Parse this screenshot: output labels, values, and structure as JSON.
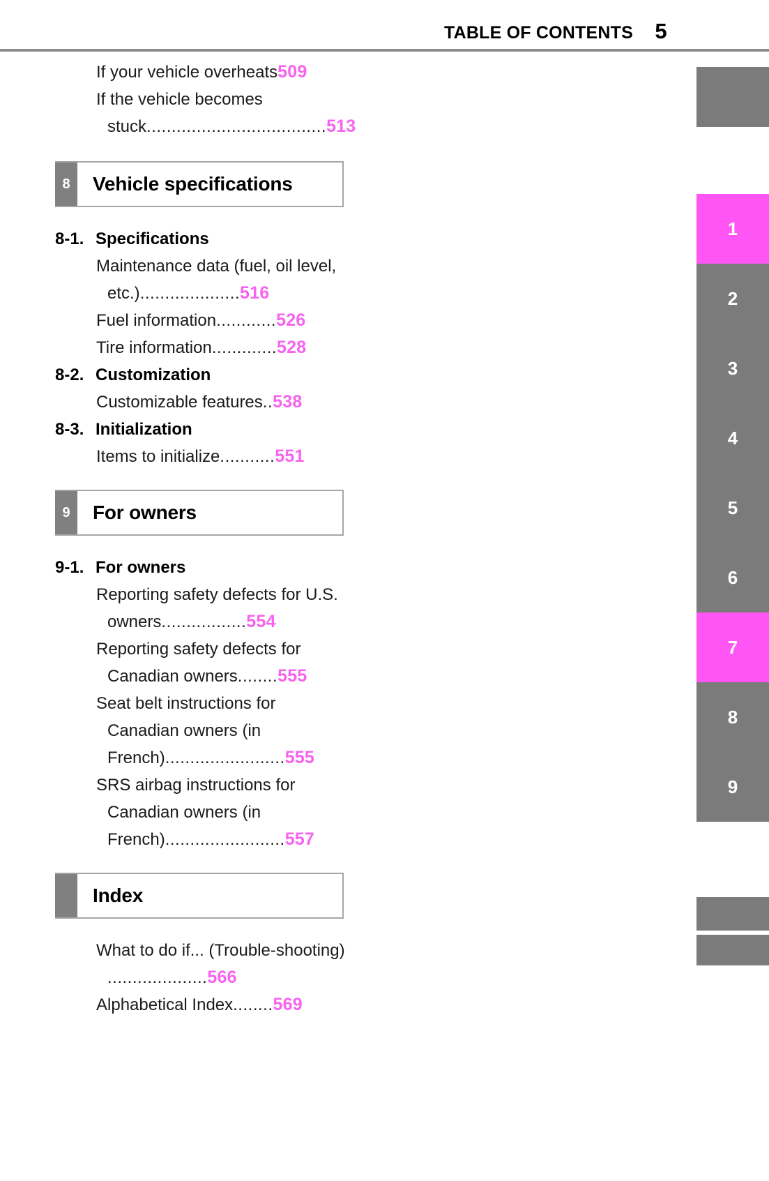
{
  "header": {
    "title": "TABLE OF CONTENTS",
    "page_number": "5"
  },
  "colors": {
    "page_number_accent": "#F763F0",
    "tab_gray": "#7b7b7b",
    "tab_active": "#FF55F4",
    "rule_gray": "#8c8c8c"
  },
  "toc": {
    "leading_entries": [
      {
        "title": "If your vehicle overheats",
        "leader": "",
        "page": "509"
      },
      {
        "title": "If the vehicle becomes stuck",
        "leader": "....................................",
        "page": "513"
      }
    ],
    "chapters": [
      {
        "number": "8",
        "title": "Vehicle specifications",
        "sections": [
          {
            "number": "8-1.",
            "title": "Specifications",
            "entries": [
              {
                "title": "Maintenance data (fuel, oil level, etc.)",
                "leader": "....................",
                "page": "516"
              },
              {
                "title": "Fuel information",
                "leader": "............",
                "page": "526"
              },
              {
                "title": "Tire information",
                "leader": ".............",
                "page": "528"
              }
            ]
          },
          {
            "number": "8-2.",
            "title": "Customization",
            "entries": [
              {
                "title": "Customizable features",
                "leader": "..",
                "page": "538"
              }
            ]
          },
          {
            "number": "8-3.",
            "title": "Initialization",
            "entries": [
              {
                "title": "Items to initialize",
                "leader": "...........",
                "page": "551"
              }
            ]
          }
        ]
      },
      {
        "number": "9",
        "title": "For owners",
        "sections": [
          {
            "number": "9-1.",
            "title": "For owners",
            "entries": [
              {
                "title": "Reporting safety defects for U.S. owners",
                "leader": ".................",
                "page": "554"
              },
              {
                "title": "Reporting safety defects for Canadian owners",
                "leader": "........",
                "page": "555"
              },
              {
                "title": "Seat belt instructions for Canadian owners (in French)",
                "leader": "........................",
                "page": "555"
              },
              {
                "title": "SRS airbag instructions for Canadian owners (in French)",
                "leader": "........................",
                "page": "557"
              }
            ]
          }
        ]
      },
      {
        "number": "",
        "title": "Index",
        "sections": [
          {
            "number": "",
            "title": "",
            "entries": [
              {
                "title": "What to do if... (Trouble-shooting) ",
                "leader": "....................",
                "page": "566"
              },
              {
                "title": "Alphabetical Index",
                "leader": "........",
                "page": "569"
              }
            ]
          }
        ]
      }
    ]
  },
  "side_tabs": [
    {
      "label": "",
      "active": false
    },
    {
      "label": "1",
      "active": true
    },
    {
      "label": "2",
      "active": false
    },
    {
      "label": "3",
      "active": false
    },
    {
      "label": "4",
      "active": false
    },
    {
      "label": "5",
      "active": false
    },
    {
      "label": "6",
      "active": false
    },
    {
      "label": "7",
      "active": true
    },
    {
      "label": "8",
      "active": false
    },
    {
      "label": "9",
      "active": false
    },
    {
      "label": "",
      "active": false
    },
    {
      "label": "",
      "active": false
    }
  ]
}
